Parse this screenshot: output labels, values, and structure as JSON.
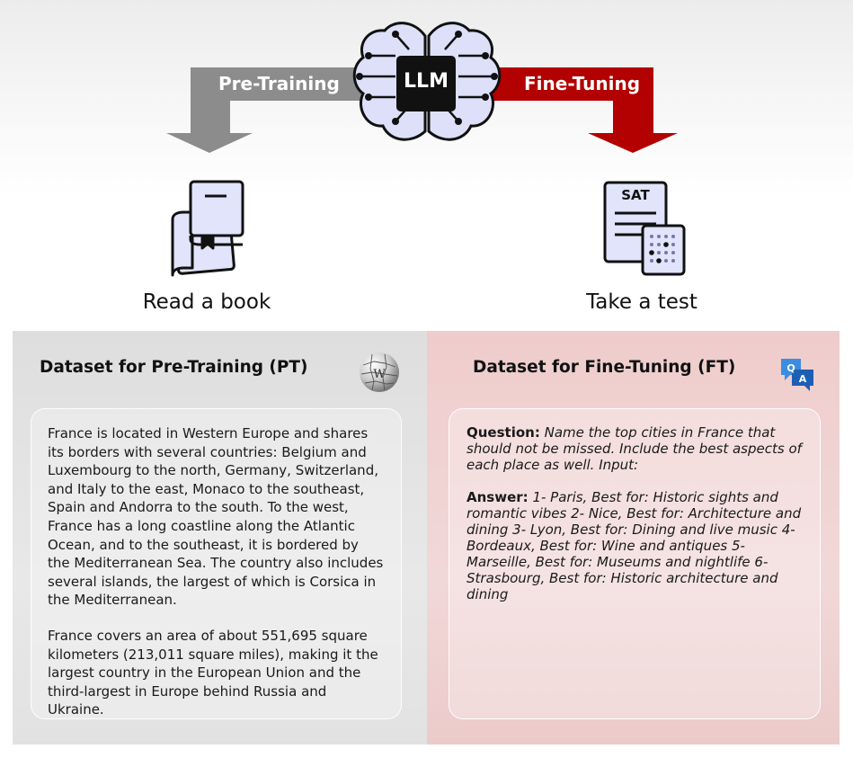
{
  "diagram": {
    "center_label": "LLM",
    "left_arrow_label": "Pre-Training",
    "right_arrow_label": "Fine-Tuning",
    "left_caption": "Read a book",
    "right_caption": "Take a test",
    "test_sheet_label": "SAT",
    "qa_icon_letters": [
      "Q",
      "A"
    ],
    "colors": {
      "left_arrow": "#8c8c8c",
      "right_arrow": "#b30000",
      "chip": "#111111",
      "brain_fill": "#dde0f8"
    }
  },
  "pt_panel": {
    "title": "Dataset for Pre-Training (PT)",
    "icon": "wikipedia-globe-icon",
    "paragraphs": [
      "France is located in Western Europe and shares its borders with several countries: Belgium and Luxembourg to the north, Germany, Switzerland, and Italy to the east, Monaco to the southeast, Spain and Andorra to the south. To the west, France has a long coastline along the Atlantic Ocean, and to the southeast, it is bordered by the Mediterranean Sea. The country also includes several islands, the largest of which is Corsica in the Mediterranean.",
      "France covers an area of about 551,695 square kilometers (213,011 square miles), making it the largest country in the European Union and the third-largest in Europe behind Russia and Ukraine."
    ]
  },
  "ft_panel": {
    "title": "Dataset for Fine-Tuning (FT)",
    "icon": "qa-chat-icon",
    "question_label": "Question:",
    "question_text": "Name the top cities in France that should not be missed. Include the best aspects of each place as well. Input:",
    "answer_label": "Answer:",
    "answer_text": "1- Paris, Best for: Historic sights and romantic vibes 2- Nice, Best for: Architecture and dining 3- Lyon, Best for: Dining and live music 4- Bordeaux, Best for: Wine and antiques 5- Marseille, Best for: Museums and nightlife 6- Strasbourg, Best for: Historic architecture and dining"
  }
}
